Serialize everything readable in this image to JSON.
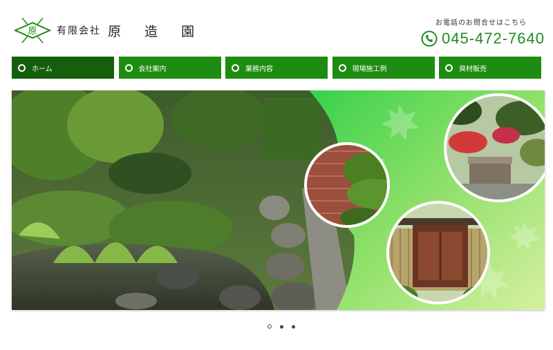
{
  "header": {
    "company_type": "有限会社",
    "company_name": "原 造 園",
    "logo_mark_char": "原",
    "contact_note": "お電話のお問合せはこちら",
    "phone": "045-472-7640"
  },
  "nav": {
    "items": [
      {
        "label": "ホーム",
        "active": true
      },
      {
        "label": "会社案内",
        "active": false
      },
      {
        "label": "業務内容",
        "active": false
      },
      {
        "label": "現場施工例",
        "active": false
      },
      {
        "label": "資材販売",
        "active": false
      }
    ]
  },
  "slider": {
    "slide_count": 3,
    "current_slide": 1
  },
  "colors": {
    "brand_green": "#1e8c10",
    "nav_active": "#155e0b",
    "phone_green": "#1f8a1f"
  },
  "icons": [
    "logo-diamond-icon",
    "phone-icon",
    "nav-bullet-icon"
  ]
}
